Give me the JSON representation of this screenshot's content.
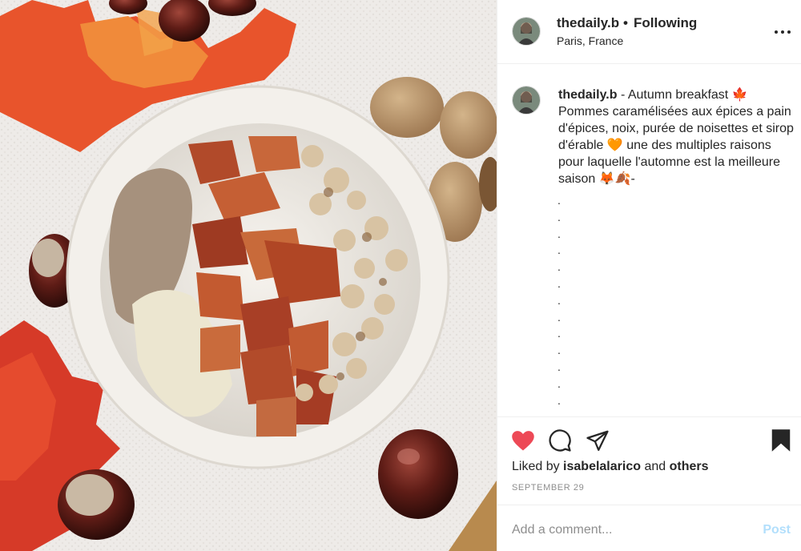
{
  "post": {
    "username": "thedaily.b",
    "dot": "•",
    "follow_status": "Following",
    "location": "Paris, France",
    "more_icon": "more-horizontal-icon"
  },
  "caption": {
    "username": "thedaily.b",
    "text": " - Autumn breakfast 🍁 Pommes caramélisées aux épices a pain d'épices, noix, purée de noisettes et sirop d'érable 🧡 une des multiples raisons pour laquelle l'automne est la meilleure saison 🦊🍂-",
    "dot_lines": [
      ".",
      ".",
      ".",
      ".",
      ".",
      ".",
      ".",
      ".",
      ".",
      ".",
      ".",
      ".",
      "."
    ]
  },
  "actions": {
    "like_icon": "heart-filled-icon",
    "comment_icon": "comment-icon",
    "share_icon": "send-icon",
    "save_icon": "bookmark-filled-icon",
    "like_color": "#ed4956"
  },
  "likes": {
    "prefix": "Liked by ",
    "user": "isabelalarico",
    "middle": " and ",
    "others": "others"
  },
  "date": "SEPTEMBER 29",
  "comment_box": {
    "placeholder": "Add a comment...",
    "post_label": "Post",
    "post_color": "#b2dffc"
  }
}
